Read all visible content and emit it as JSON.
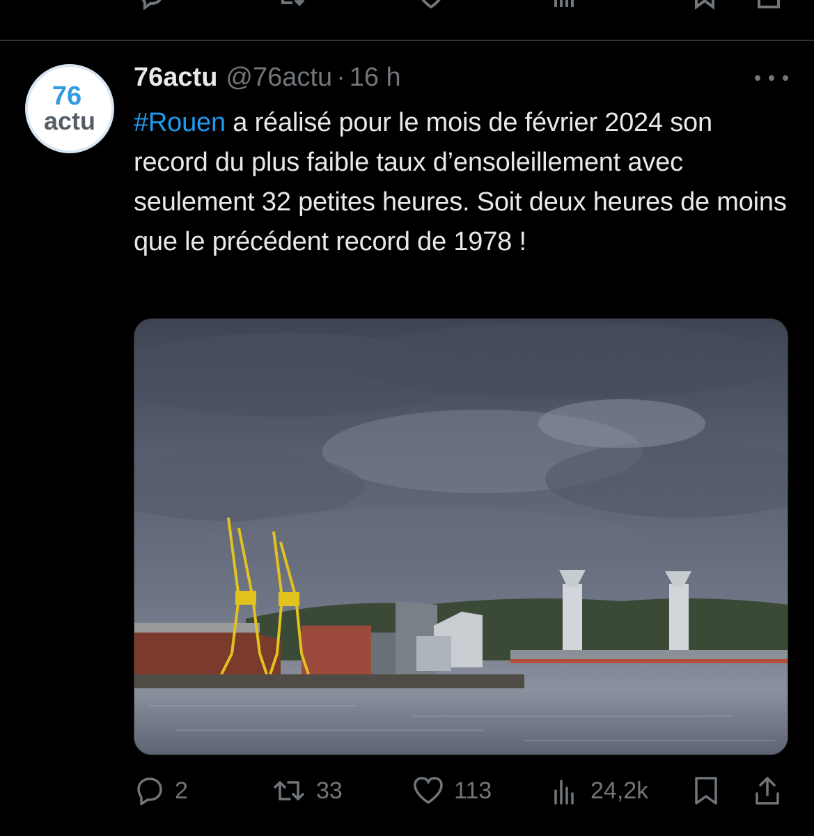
{
  "tweet": {
    "author_name": "76actu",
    "author_handle": "@76actu",
    "separator": "·",
    "time": "16 h",
    "avatar_line1": "76",
    "avatar_line2": "actu",
    "hashtag": "#Rouen",
    "text": " a réalisé pour le mois de février 2024 son record du plus faible taux d’ensoleillement avec seulement 32 petites heures. Soit deux heures de moins que le précédent record de 1978 !",
    "more_icon": "more-dots-icon",
    "media_description_icon": "photo",
    "actions": {
      "replies": "2",
      "retweets": "33",
      "likes": "113",
      "views": "24,2k"
    }
  },
  "colors": {
    "background": "#000000",
    "text": "#e7e9ea",
    "muted": "#71767b",
    "link": "#1d9bf0",
    "divider": "#2f3336"
  },
  "icons": [
    "reply-icon",
    "retweet-icon",
    "like-icon",
    "views-icon",
    "bookmark-icon",
    "share-icon"
  ]
}
